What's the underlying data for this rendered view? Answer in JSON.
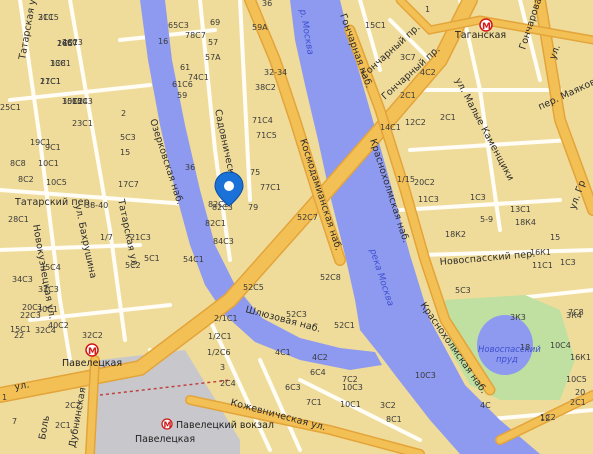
{
  "map": {
    "water_labels": {
      "moskva_top": "р. Москва",
      "moskva_mid": "река Москва",
      "pond_1": "Новоспасский",
      "pond_2": "пруд"
    },
    "streets": {
      "goncharny_pr_1": "Гончарный пр.",
      "goncharny_pr_2": "Гончарный пр.",
      "goncharnaya_nab": "Гончарная наб.",
      "sadovnicheskaya": "Садовническая",
      "ozerkovskaya": "Озерковская наб.",
      "kosmodamianskaya": "Космодамианская наб.",
      "krasnokholmskaya_1": "Краснохолмская наб.",
      "krasnokholmskaya_2": "Краснохолмская наб.",
      "shlyuzovaya": "Шлюзовая наб.",
      "kozhevnicheskaya": "Кожевническая ул.",
      "tatarskaya_top": "Татарская ул.",
      "tatarskaya_mid": "Татарская ул.",
      "bakhrushina": "ул. Бахрушина",
      "novokuznetskaya": "Новокузнецкая ул.",
      "tatarsky_per": "Татарский пер.",
      "novospassky_per": "Новоспасский пер.",
      "malye_kamenshchiki": "ул. Малые Каменщики",
      "mayakovskogo": "пер. Маяковского",
      "dubininskaya": "Дубнинская",
      "bolshaya": "Боль",
      "tagan_ul": "ул.",
      "pavel_ul": "ул.",
      "gonch_edge": "ул. Гр",
      "yauza_edge": "Гончарова"
    },
    "metro": {
      "taganskaya": "Таганская",
      "paveletskaya": "Павелецкая",
      "paveletsky_vokzal": "Павелецкий вокзал",
      "paveletskaya_sq": "Павелецкая"
    },
    "buildings": [
      "21С5",
      "26С3",
      "26С7",
      "33С1",
      "27С1",
      "35С2",
      "35С3",
      "23С1",
      "19С1",
      "8С8",
      "10С1",
      "9С1",
      "10С5",
      "8С2",
      "28С1",
      "25С1",
      "35С4",
      "32С3",
      "30С1",
      "34С3",
      "20С1",
      "22С3",
      "40С2",
      "32С4",
      "15С1",
      "22",
      "32С2",
      "1",
      "2С2",
      "2С1",
      "7",
      "2",
      "38-40",
      "17С7",
      "1/7",
      "21С3",
      "5С2",
      "5С3",
      "15",
      "16",
      "65С3",
      "61",
      "61С6",
      "59",
      "69",
      "78С7",
      "57",
      "57А",
      "74С1",
      "59А",
      "36",
      "32-34",
      "38С2",
      "36",
      "82С3",
      "82С2",
      "82С1",
      "84С3",
      "75",
      "77С1",
      "79",
      "71С4",
      "71С5",
      "54С1",
      "52С5",
      "52С3",
      "52С8",
      "52С7",
      "52С1",
      "5С1",
      "2/1С1",
      "1/2С1",
      "1/2С6",
      "3",
      "2С4",
      "4С1",
      "4С2",
      "6С4",
      "6С3",
      "7С1",
      "10С1",
      "10С3",
      "7С2",
      "8С1",
      "3С2",
      "15С1",
      "1",
      "3С7",
      "4С2",
      "2С1",
      "12С2",
      "14С1",
      "1/15",
      "20С2",
      "11С3",
      "1С3",
      "5-9",
      "13С1",
      "18К4",
      "18К2",
      "16К1",
      "11С1",
      "1С3",
      "5С3",
      "3К3",
      "3К4",
      "16К1",
      "2С1",
      "7С8",
      "10С4",
      "10С5",
      "12",
      "20",
      "4С",
      "15",
      "18",
      "10С3",
      "1С2",
      "2С1",
      "3С1",
      "4С1",
      "1С5",
      "1С8",
      "11С1",
      "10С1",
      "1С4"
    ]
  }
}
